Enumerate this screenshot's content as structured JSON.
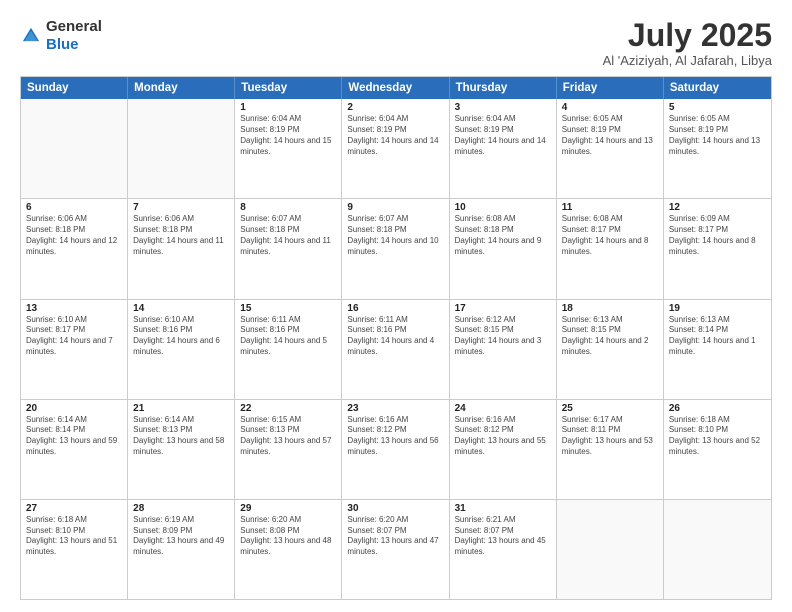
{
  "header": {
    "logo": {
      "general": "General",
      "blue": "Blue"
    },
    "title": "July 2025",
    "location": "Al 'Aziziyah, Al Jafarah, Libya"
  },
  "calendar": {
    "days_of_week": [
      "Sunday",
      "Monday",
      "Tuesday",
      "Wednesday",
      "Thursday",
      "Friday",
      "Saturday"
    ],
    "weeks": [
      [
        {
          "day": "",
          "empty": true
        },
        {
          "day": "",
          "empty": true
        },
        {
          "day": "1",
          "sunrise": "6:04 AM",
          "sunset": "8:19 PM",
          "daylight": "14 hours and 15 minutes."
        },
        {
          "day": "2",
          "sunrise": "6:04 AM",
          "sunset": "8:19 PM",
          "daylight": "14 hours and 14 minutes."
        },
        {
          "day": "3",
          "sunrise": "6:04 AM",
          "sunset": "8:19 PM",
          "daylight": "14 hours and 14 minutes."
        },
        {
          "day": "4",
          "sunrise": "6:05 AM",
          "sunset": "8:19 PM",
          "daylight": "14 hours and 13 minutes."
        },
        {
          "day": "5",
          "sunrise": "6:05 AM",
          "sunset": "8:19 PM",
          "daylight": "14 hours and 13 minutes."
        }
      ],
      [
        {
          "day": "6",
          "sunrise": "6:06 AM",
          "sunset": "8:18 PM",
          "daylight": "14 hours and 12 minutes."
        },
        {
          "day": "7",
          "sunrise": "6:06 AM",
          "sunset": "8:18 PM",
          "daylight": "14 hours and 11 minutes."
        },
        {
          "day": "8",
          "sunrise": "6:07 AM",
          "sunset": "8:18 PM",
          "daylight": "14 hours and 11 minutes."
        },
        {
          "day": "9",
          "sunrise": "6:07 AM",
          "sunset": "8:18 PM",
          "daylight": "14 hours and 10 minutes."
        },
        {
          "day": "10",
          "sunrise": "6:08 AM",
          "sunset": "8:18 PM",
          "daylight": "14 hours and 9 minutes."
        },
        {
          "day": "11",
          "sunrise": "6:08 AM",
          "sunset": "8:17 PM",
          "daylight": "14 hours and 8 minutes."
        },
        {
          "day": "12",
          "sunrise": "6:09 AM",
          "sunset": "8:17 PM",
          "daylight": "14 hours and 8 minutes."
        }
      ],
      [
        {
          "day": "13",
          "sunrise": "6:10 AM",
          "sunset": "8:17 PM",
          "daylight": "14 hours and 7 minutes."
        },
        {
          "day": "14",
          "sunrise": "6:10 AM",
          "sunset": "8:16 PM",
          "daylight": "14 hours and 6 minutes."
        },
        {
          "day": "15",
          "sunrise": "6:11 AM",
          "sunset": "8:16 PM",
          "daylight": "14 hours and 5 minutes."
        },
        {
          "day": "16",
          "sunrise": "6:11 AM",
          "sunset": "8:16 PM",
          "daylight": "14 hours and 4 minutes."
        },
        {
          "day": "17",
          "sunrise": "6:12 AM",
          "sunset": "8:15 PM",
          "daylight": "14 hours and 3 minutes."
        },
        {
          "day": "18",
          "sunrise": "6:13 AM",
          "sunset": "8:15 PM",
          "daylight": "14 hours and 2 minutes."
        },
        {
          "day": "19",
          "sunrise": "6:13 AM",
          "sunset": "8:14 PM",
          "daylight": "14 hours and 1 minute."
        }
      ],
      [
        {
          "day": "20",
          "sunrise": "6:14 AM",
          "sunset": "8:14 PM",
          "daylight": "13 hours and 59 minutes."
        },
        {
          "day": "21",
          "sunrise": "6:14 AM",
          "sunset": "8:13 PM",
          "daylight": "13 hours and 58 minutes."
        },
        {
          "day": "22",
          "sunrise": "6:15 AM",
          "sunset": "8:13 PM",
          "daylight": "13 hours and 57 minutes."
        },
        {
          "day": "23",
          "sunrise": "6:16 AM",
          "sunset": "8:12 PM",
          "daylight": "13 hours and 56 minutes."
        },
        {
          "day": "24",
          "sunrise": "6:16 AM",
          "sunset": "8:12 PM",
          "daylight": "13 hours and 55 minutes."
        },
        {
          "day": "25",
          "sunrise": "6:17 AM",
          "sunset": "8:11 PM",
          "daylight": "13 hours and 53 minutes."
        },
        {
          "day": "26",
          "sunrise": "6:18 AM",
          "sunset": "8:10 PM",
          "daylight": "13 hours and 52 minutes."
        }
      ],
      [
        {
          "day": "27",
          "sunrise": "6:18 AM",
          "sunset": "8:10 PM",
          "daylight": "13 hours and 51 minutes."
        },
        {
          "day": "28",
          "sunrise": "6:19 AM",
          "sunset": "8:09 PM",
          "daylight": "13 hours and 49 minutes."
        },
        {
          "day": "29",
          "sunrise": "6:20 AM",
          "sunset": "8:08 PM",
          "daylight": "13 hours and 48 minutes."
        },
        {
          "day": "30",
          "sunrise": "6:20 AM",
          "sunset": "8:07 PM",
          "daylight": "13 hours and 47 minutes."
        },
        {
          "day": "31",
          "sunrise": "6:21 AM",
          "sunset": "8:07 PM",
          "daylight": "13 hours and 45 minutes."
        },
        {
          "day": "",
          "empty": true
        },
        {
          "day": "",
          "empty": true
        }
      ]
    ]
  }
}
